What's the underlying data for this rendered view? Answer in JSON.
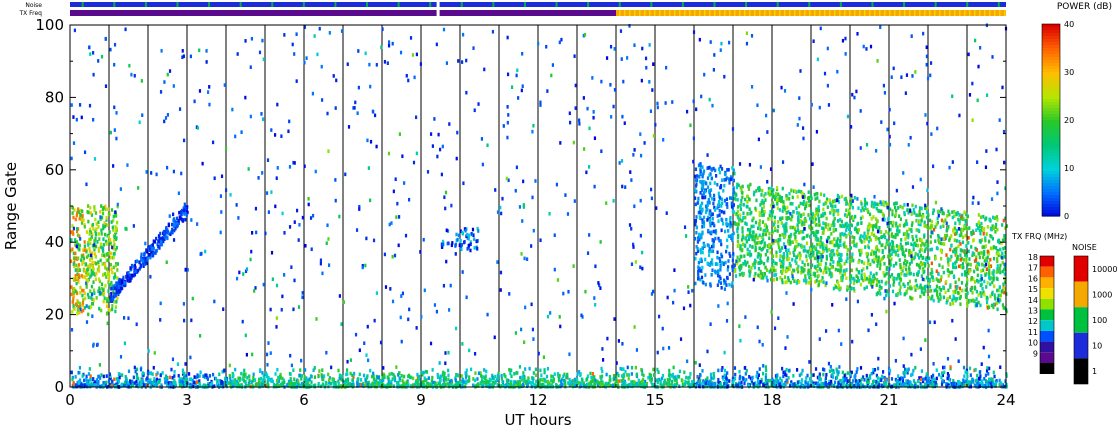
{
  "chart_data": {
    "type": "heatmap",
    "xlabel": "UT hours",
    "ylabel": "Range Gate",
    "xlim": [
      0,
      24
    ],
    "ylim": [
      0,
      100
    ],
    "x_ticks": [
      0,
      3,
      6,
      9,
      12,
      15,
      18,
      21,
      24
    ],
    "x_tick_labels": [
      "0",
      "3",
      "6",
      "9",
      "12",
      "15",
      "18",
      "21",
      "24"
    ],
    "y_ticks": [
      0,
      20,
      40,
      60,
      80,
      100
    ],
    "y_tick_labels": [
      "0",
      "20",
      "40",
      "60",
      "80",
      "100"
    ],
    "hour_gridlines": [
      1,
      2,
      3,
      4,
      5,
      6,
      7,
      8,
      9,
      10,
      11,
      12,
      13,
      14,
      15,
      16,
      17,
      18,
      19,
      20,
      21,
      22,
      23
    ],
    "top_bars": {
      "noise_label": "Noise",
      "txfreq_label": "TX Freq",
      "txfreq_change_hour": 14.0,
      "colors": {
        "noise": "#1c2cd8",
        "txfreq_before": "#5a0a8c",
        "txfreq_after": "#f5a800"
      }
    },
    "scatter_regions": [
      {
        "name": "ground-scatter",
        "x_range": [
          0,
          24
        ],
        "gate_range": [
          0,
          5
        ],
        "power_db": 8
      },
      {
        "name": "early-echo",
        "x_range": [
          0,
          1.2
        ],
        "gate_range": [
          20,
          50
        ],
        "power_db": 22
      },
      {
        "name": "rising-arc",
        "x_range": [
          1.0,
          3.0
        ],
        "gate_range": [
          25,
          50
        ],
        "power_db": 6
      },
      {
        "name": "mid-echo",
        "x_range": [
          9.5,
          10.5
        ],
        "gate_range": [
          38,
          44
        ],
        "power_db": 4
      },
      {
        "name": "evening-band",
        "x_range": [
          16,
          24
        ],
        "gate_range": [
          25,
          60
        ],
        "power_db": 18
      }
    ],
    "power_colorbar": {
      "title": "POWER (dB)",
      "range": [
        0,
        40
      ],
      "ticks": [
        "40",
        "30",
        "20",
        "10",
        "0"
      ]
    },
    "txfreq_colorbar": {
      "title": "TX FRQ (MHz)",
      "labels": [
        "18",
        "17",
        "16",
        "15",
        "14",
        "13",
        "12",
        "11",
        "10",
        "9"
      ],
      "colors": [
        "#e00000",
        "#ff6000",
        "#ffb000",
        "#f0e000",
        "#90e000",
        "#00c040",
        "#00c8c8",
        "#0050ff",
        "#3010a0",
        "#5a0a8c",
        "#000000"
      ]
    },
    "noise_colorbar": {
      "title": "NOISE",
      "labels": [
        "10000",
        "1000",
        "100",
        "10",
        "1"
      ],
      "colors": [
        "#e00000",
        "#f5a800",
        "#00c040",
        "#1c2cd8",
        "#000000"
      ]
    }
  }
}
